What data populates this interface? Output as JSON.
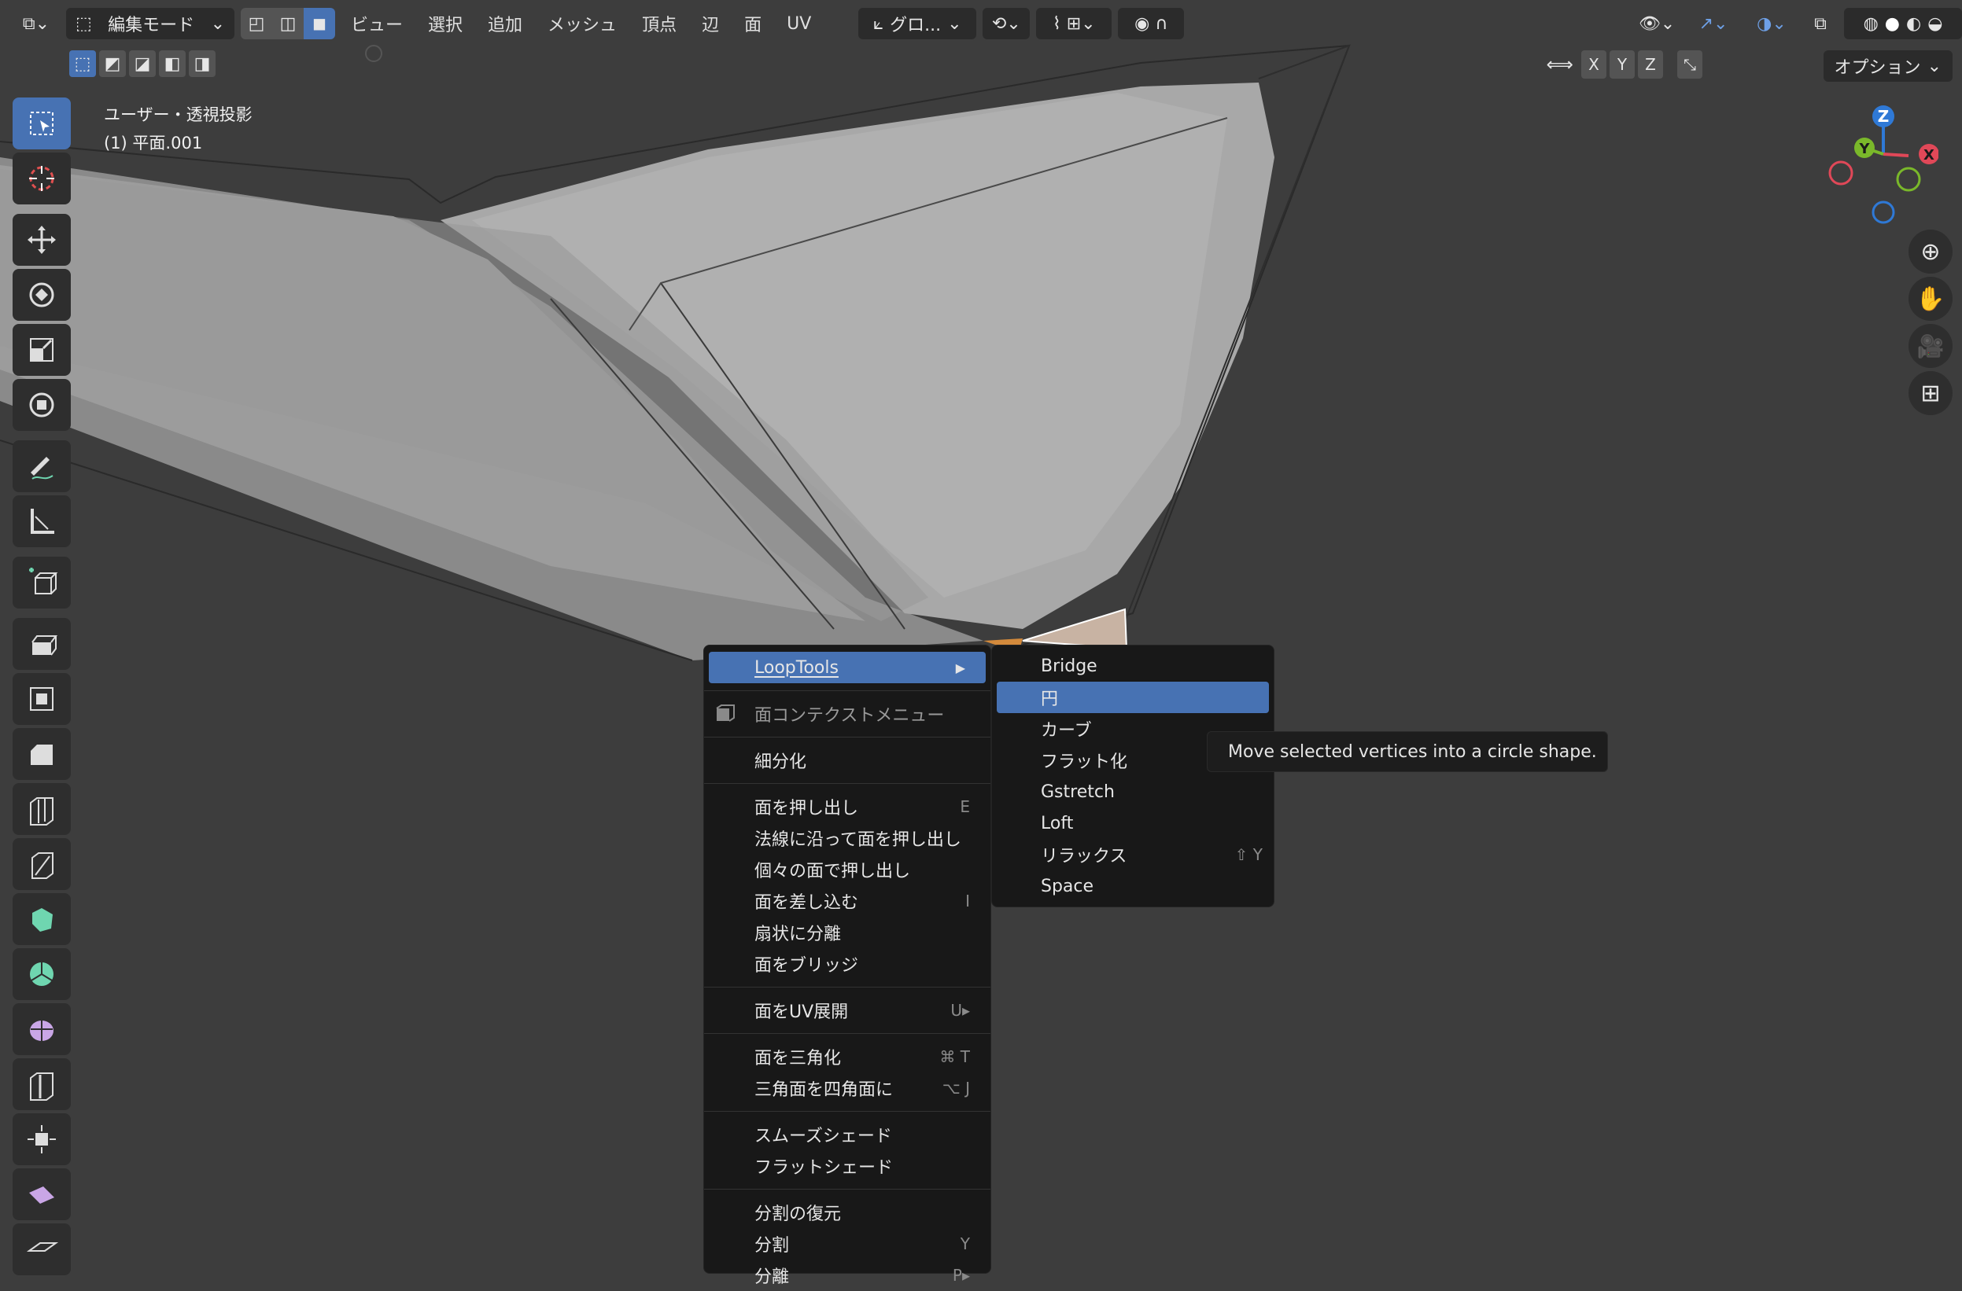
{
  "header": {
    "mode_label": "編集モード",
    "menus": [
      "ビュー",
      "選択",
      "追加",
      "メッシュ",
      "頂点",
      "辺",
      "面",
      "UV"
    ],
    "transform_orientation": "グロ...",
    "axis": [
      "X",
      "Y",
      "Z"
    ],
    "options_label": "オプション"
  },
  "view": {
    "projection": "ユーザー・透視投影",
    "object": "(1) 平面.001"
  },
  "gizmo": {
    "z": "Z",
    "y": "Y",
    "x": "X"
  },
  "context_menu": {
    "looptools": "LoopTools",
    "title": "面コンテクストメニュー",
    "items": [
      {
        "label": "細分化",
        "shortcut": ""
      },
      {
        "label": "面を押し出し",
        "shortcut": "E"
      },
      {
        "label": "法線に沿って面を押し出し",
        "shortcut": ""
      },
      {
        "label": "個々の面で押し出し",
        "shortcut": ""
      },
      {
        "label": "面を差し込む",
        "shortcut": "I"
      },
      {
        "label": "扇状に分離",
        "shortcut": ""
      },
      {
        "label": "面をブリッジ",
        "shortcut": ""
      },
      {
        "label": "面をUV展開",
        "shortcut": "U▸"
      },
      {
        "label": "面を三角化",
        "shortcut": "⌘ T"
      },
      {
        "label": "三角面を四角面に",
        "shortcut": "⌥ J"
      },
      {
        "label": "スムーズシェード",
        "shortcut": ""
      },
      {
        "label": "フラットシェード",
        "shortcut": ""
      },
      {
        "label": "分割の復元",
        "shortcut": ""
      },
      {
        "label": "分割",
        "shortcut": "Y"
      },
      {
        "label": "分離",
        "shortcut": "P▸"
      }
    ]
  },
  "submenu": {
    "items": [
      {
        "label": "Bridge",
        "shortcut": ""
      },
      {
        "label": "円",
        "shortcut": ""
      },
      {
        "label": "カーブ",
        "shortcut": ""
      },
      {
        "label": "フラット化",
        "shortcut": ""
      },
      {
        "label": "Gstretch",
        "shortcut": ""
      },
      {
        "label": "Loft",
        "shortcut": ""
      },
      {
        "label": "リラックス",
        "shortcut": "⇧ Y"
      },
      {
        "label": "Space",
        "shortcut": ""
      }
    ]
  },
  "tooltip": "Move selected vertices into a circle shape.",
  "colors": {
    "accent": "#4772b3",
    "menu_bg": "#181818",
    "viewport_bg": "#3d3d3d"
  }
}
